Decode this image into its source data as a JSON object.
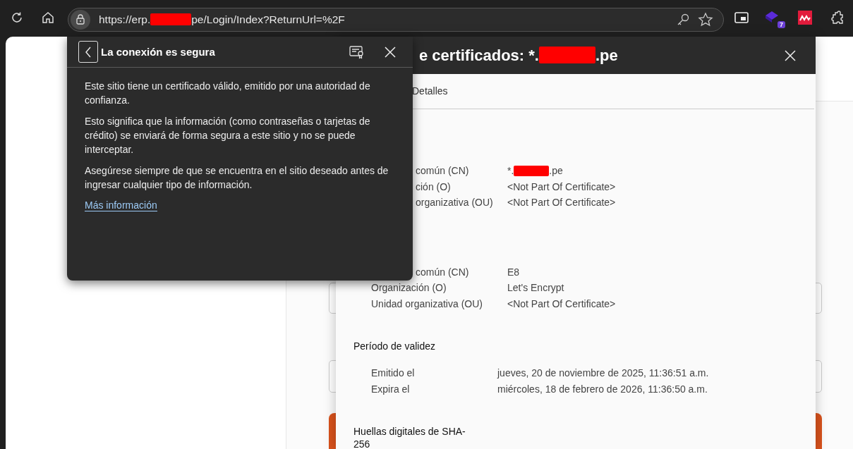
{
  "toolbar": {
    "url": [
      "https://erp.",
      "pe/Login/Index?ReturnUrl=%2F"
    ],
    "extension_badge": "7"
  },
  "certificate_dialog": {
    "title": [
      "e certificados: *.",
      ".pe"
    ],
    "tabs": [
      {
        "label": "Detalles",
        "selected": false
      }
    ],
    "sections": [
      {
        "kind": "fields",
        "rows": [
          {
            "label": "común (CN)",
            "covered": true,
            "value": [
              "*.",
              ".pe"
            ]
          },
          {
            "label": "ción (O)",
            "covered": true,
            "value": [
              "<Not Part Of Certificate>"
            ]
          },
          {
            "label": "organizativa (OU)",
            "covered": true,
            "value": [
              "<Not Part Of Certificate>"
            ]
          }
        ]
      },
      {
        "kind": "fields",
        "rows": [
          {
            "label": "común (CN)",
            "covered": true,
            "value": [
              "E8"
            ]
          },
          {
            "label": "Organización (O)",
            "covered": false,
            "value": [
              "Let's Encrypt"
            ]
          },
          {
            "label": "Unidad organizativa (OU)",
            "covered": false,
            "value": [
              "<Not Part Of Certificate>"
            ]
          }
        ]
      },
      {
        "kind": "dates",
        "title": "Período de validez",
        "rows": [
          {
            "label": "Emitido el",
            "covered": false,
            "value": [
              "jueves, 20 de noviembre de 2025, 11:36:51 a.m."
            ]
          },
          {
            "label": "Expira el",
            "covered": false,
            "value": [
              "miércoles, 18 de febrero de 2026, 11:36:50 a.m."
            ]
          }
        ]
      },
      {
        "kind": "fields",
        "title": "Huellas digitales de SHA-256"
      }
    ]
  },
  "security_popup": {
    "title": "La conexión es segura",
    "paragraphs": [
      "Este sitio tiene un certificado válido, emitido por una autoridad de confianza.",
      "Esto significa que la información (como contraseñas o tarjetas de crédito) se enviará de forma segura a este sitio y no se puede interceptar.",
      "Asegúrese siempre de que se encuentra en el sitio deseado antes de ingresar cualquier tipo de información."
    ],
    "link": "Más información"
  }
}
